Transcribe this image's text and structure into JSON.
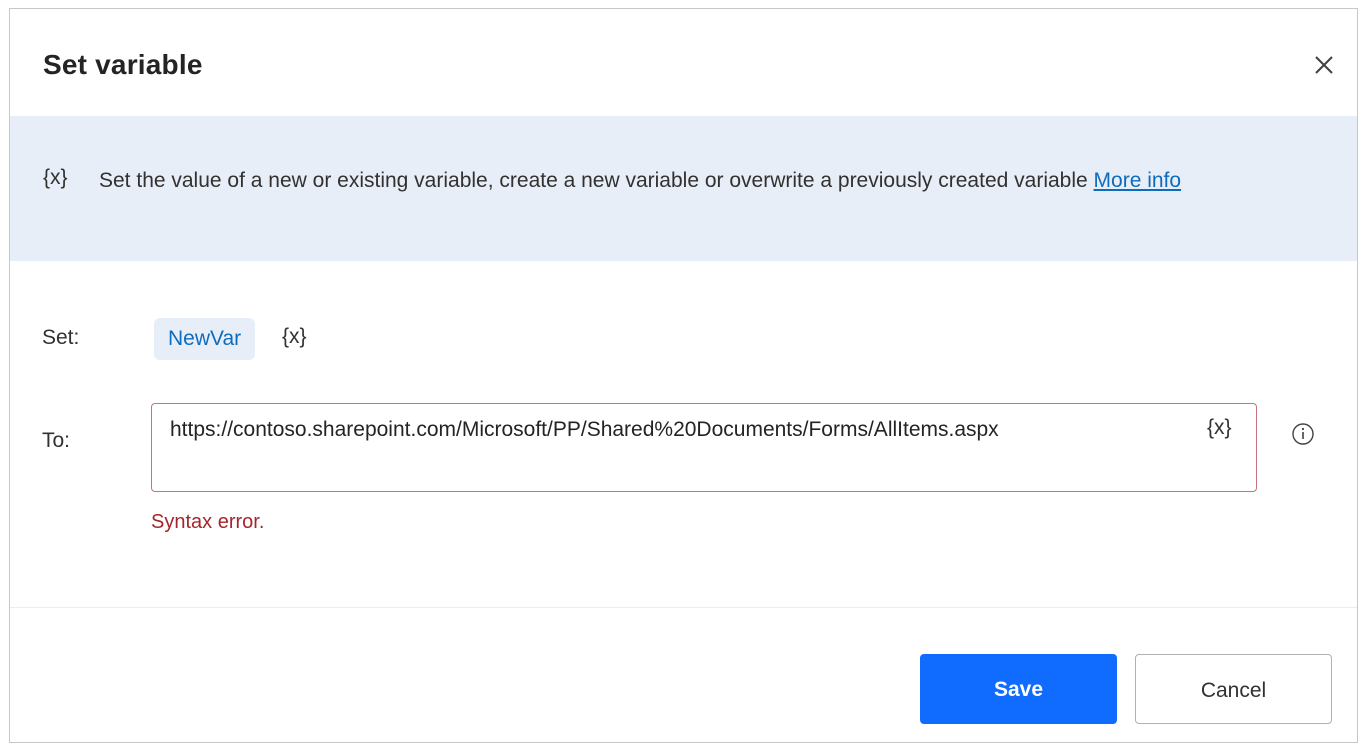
{
  "dialog": {
    "title": "Set variable",
    "close_icon": "close-icon"
  },
  "banner": {
    "icon_text": "{x}",
    "description": "Set the value of a new or existing variable, create a new variable or overwrite a previously created variable",
    "link_text": "More info"
  },
  "form": {
    "set_label": "Set:",
    "variable_name": "NewVar",
    "variable_icon_text": "{x}",
    "to_label": "To:",
    "to_value": "https://contoso.sharepoint.com/Microsoft/PP/Shared%20Documents/Forms/AllItems.aspx",
    "to_var_icon_text": "{x}",
    "info_icon": "info-icon",
    "error_message": "Syntax error."
  },
  "footer": {
    "save_label": "Save",
    "cancel_label": "Cancel"
  },
  "colors": {
    "primary": "#0f6cff",
    "banner_bg": "#e8eef8",
    "link": "#0f6cbd",
    "error": "#a4262c",
    "error_border": "#c4747a"
  }
}
